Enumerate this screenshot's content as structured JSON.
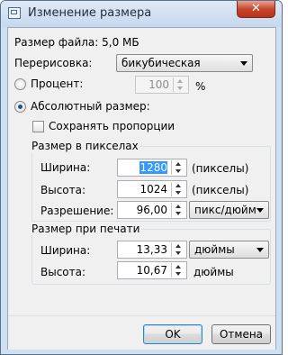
{
  "window": {
    "title": "Изменение размера",
    "close_glyph": "✕"
  },
  "file_size": "Размер файла: 5,0 МБ",
  "resample": {
    "label": "Перерисовка:",
    "value": "бикубическая"
  },
  "percent": {
    "label": "Процент:",
    "value": "100",
    "unit": "%",
    "selected": false,
    "enabled": false
  },
  "absolute": {
    "label": "Абсолютный размер:",
    "selected": true
  },
  "keep_ratio": {
    "label": "Сохранять пропорции",
    "checked": false
  },
  "pixel_group": {
    "title": "Размер в пикселах",
    "width_label": "Ширина:",
    "width_value": "1280",
    "width_unit": "(пикселы)",
    "height_label": "Высота:",
    "height_value": "1024",
    "height_unit": "(пикселы)",
    "resolution_label": "Разрешение:",
    "resolution_value": "96,00",
    "resolution_unit": "пикс/дюйм"
  },
  "print_group": {
    "title": "Размер при печати",
    "width_label": "Ширина:",
    "width_value": "13,33",
    "width_unit": "дюймы",
    "height_label": "Высота:",
    "height_value": "10,67",
    "height_unit": "дюймы"
  },
  "buttons": {
    "ok": "OK",
    "cancel": "Отмена"
  },
  "colors": {
    "selection": "#3399ff",
    "radio_dot": "#2a4f8f",
    "close_button": "#c7472e"
  }
}
